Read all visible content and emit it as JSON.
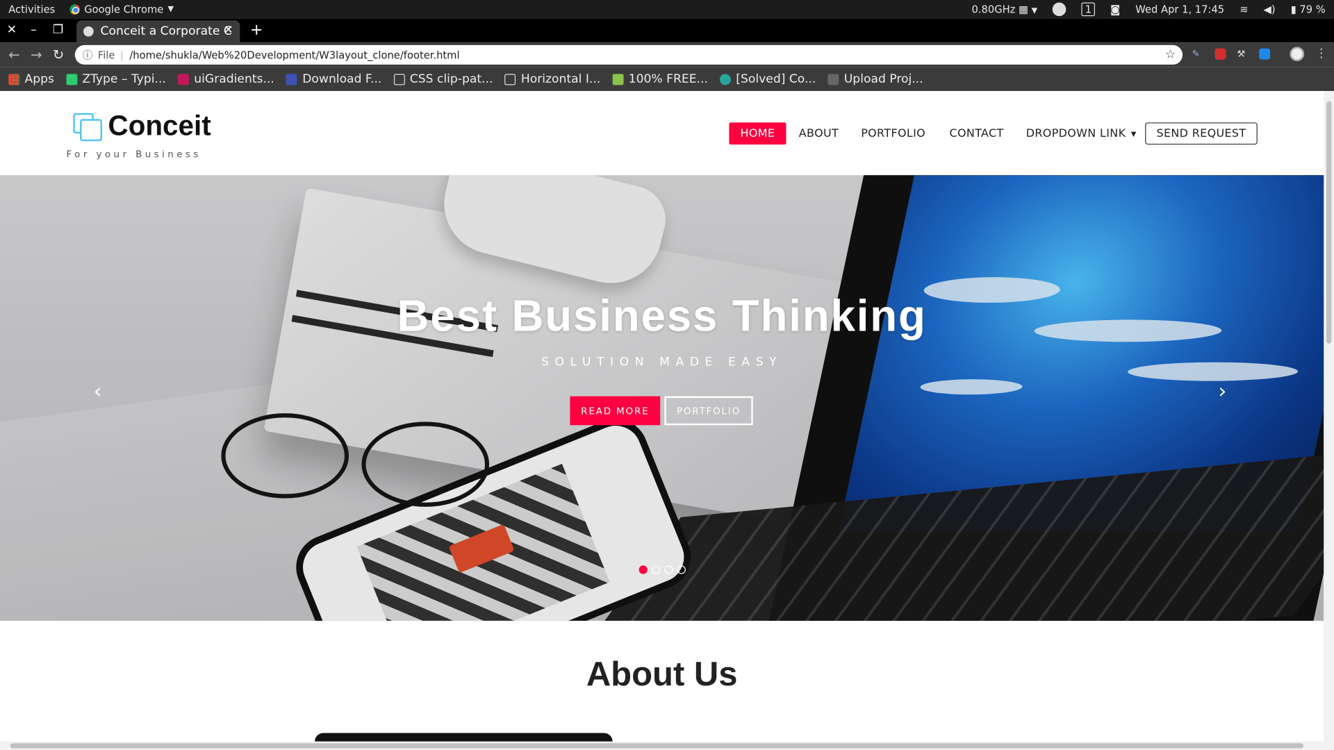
{
  "system_bar": {
    "activities": "Activities",
    "app_name": "Google Chrome",
    "cpu": "0.80GHz",
    "workspace": "1",
    "datetime": "Wed Apr  1, 17:45",
    "battery": "79 %"
  },
  "browser": {
    "tab_title": "Conceit a Corporate C",
    "address_prefix": "File",
    "url": "/home/shukla/Web%20Development/W3layout_clone/footer.html",
    "bookmarks": [
      {
        "label": "Apps",
        "icon": "apps-grid-icon",
        "color": "#ea4335"
      },
      {
        "label": "ZType – Typi...",
        "icon": "ztype-icon",
        "color": "#2ecc71"
      },
      {
        "label": "uiGradients...",
        "icon": "uigradients-icon",
        "color": "#c2185b"
      },
      {
        "label": "Download F...",
        "icon": "download-icon",
        "color": "#3f51b5"
      },
      {
        "label": "CSS clip-pat...",
        "icon": "codepen-icon",
        "color": "#dddddd"
      },
      {
        "label": "Horizontal I...",
        "icon": "codepen-icon",
        "color": "#dddddd"
      },
      {
        "label": "100% FREE...",
        "icon": "feather-icon",
        "color": "#8bc34a"
      },
      {
        "label": "[Solved] Co...",
        "icon": "bug-icon",
        "color": "#26a69a"
      },
      {
        "label": "Upload Proj...",
        "icon": "tm-icon",
        "color": "#cccccc"
      }
    ]
  },
  "site": {
    "logo_title": "Conceit",
    "logo_subtitle": "For your Business",
    "nav": {
      "home": "HOME",
      "about": "ABOUT",
      "portfolio": "PORTFOLIO",
      "contact": "CONTACT",
      "dropdown": "DROPDOWN LINK",
      "send_request": "SEND REQUEST"
    },
    "hero": {
      "title": "Best Business Thinking",
      "subtitle": "SOLUTION MADE EASY",
      "read_more": "READ MORE",
      "portfolio": "PORTFOLIO",
      "prev": "‹",
      "next": "›",
      "slide_count": 4,
      "active_slide": 1
    },
    "about_title": "About Us",
    "accent_color": "#ff0040",
    "logo_color": "#4fc3f7"
  }
}
